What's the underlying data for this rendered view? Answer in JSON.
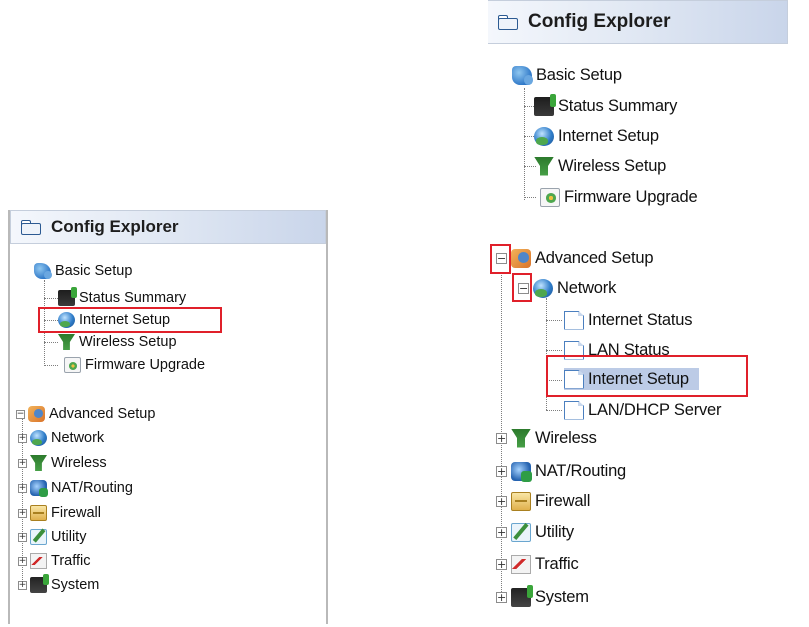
{
  "left_panel": {
    "title": "Config Explorer",
    "basic_setup": {
      "label": "Basic Setup",
      "items": [
        "Status Summary",
        "Internet Setup",
        "Wireless Setup",
        "Firmware Upgrade"
      ]
    },
    "advanced_setup": {
      "label": "Advanced Setup",
      "items": [
        "Network",
        "Wireless",
        "NAT/Routing",
        "Firewall",
        "Utility",
        "Traffic",
        "System"
      ]
    }
  },
  "right_panel": {
    "title": "Config Explorer",
    "basic_setup": {
      "label": "Basic Setup",
      "items": [
        "Status Summary",
        "Internet Setup",
        "Wireless Setup",
        "Firmware Upgrade"
      ]
    },
    "advanced_setup": {
      "label": "Advanced Setup",
      "network": {
        "label": "Network",
        "items": [
          "Internet Status",
          "LAN Status",
          "Internet Setup",
          "LAN/DHCP Server"
        ]
      },
      "items": [
        "Wireless",
        "NAT/Routing",
        "Firewall",
        "Utility",
        "Traffic",
        "System"
      ]
    }
  },
  "expander_symbols": {
    "collapsed": "+",
    "expanded": "−"
  },
  "highlight_color": "#e0202a",
  "selection_color": "#bccbe6"
}
